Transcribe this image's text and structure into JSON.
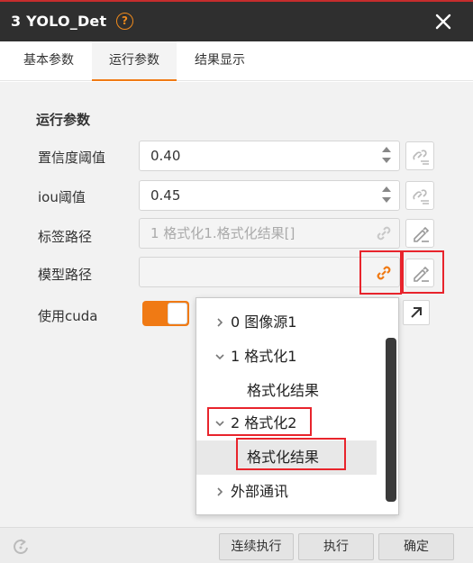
{
  "window": {
    "title": "3 YOLO_Det",
    "help_glyph": "?"
  },
  "tabs": [
    {
      "label": "基本参数",
      "active": false
    },
    {
      "label": "运行参数",
      "active": true
    },
    {
      "label": "结果显示",
      "active": false
    }
  ],
  "section": {
    "title": "运行参数"
  },
  "fields": {
    "confidence": {
      "label": "置信度阈值",
      "value": "0.40"
    },
    "iou": {
      "label": "iou阈值",
      "value": "0.45"
    },
    "label_path": {
      "label": "标签路径",
      "value": "1 格式化1.格式化结果[]"
    },
    "model_path": {
      "label": "模型路径",
      "value": ""
    },
    "use_cuda": {
      "label": "使用cuda",
      "on": true
    }
  },
  "dropdown_tree": [
    {
      "label": "0 图像源1",
      "expanded": false,
      "level": 0
    },
    {
      "label": "1 格式化1",
      "expanded": true,
      "level": 0
    },
    {
      "label": "格式化结果",
      "level": 1
    },
    {
      "label": "2 格式化2",
      "expanded": true,
      "level": 0
    },
    {
      "label": "格式化结果",
      "level": 1,
      "selected": true
    },
    {
      "label": "外部通讯",
      "expanded": false,
      "level": 0
    }
  ],
  "footer": {
    "continuous_run": "连续执行",
    "run": "执行",
    "confirm": "确定"
  },
  "colors": {
    "accent": "#f07a14",
    "highlight": "#e8242c",
    "titlebar": "#2f2f2f"
  }
}
